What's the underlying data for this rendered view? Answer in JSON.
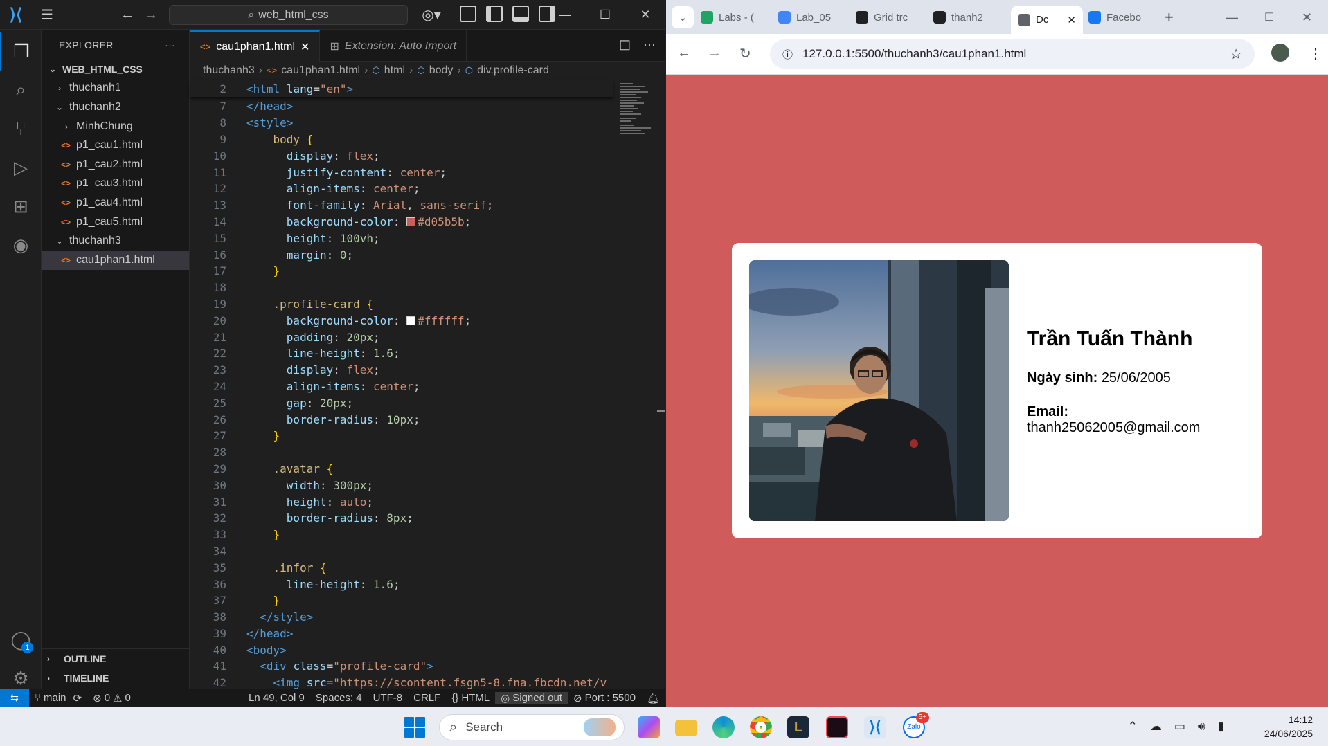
{
  "vscode": {
    "command_center": "web_html_css",
    "explorer_title": "EXPLORER",
    "workspace": "WEB_HTML_CSS",
    "tree": [
      {
        "label": "thuchanh1",
        "type": "folder",
        "open": false,
        "depth": 1
      },
      {
        "label": "thuchanh2",
        "type": "folder",
        "open": true,
        "depth": 1
      },
      {
        "label": "MinhChung",
        "type": "folder",
        "open": false,
        "depth": 2
      },
      {
        "label": "p1_cau1.html",
        "type": "file",
        "depth": 2
      },
      {
        "label": "p1_cau2.html",
        "type": "file",
        "depth": 2
      },
      {
        "label": "p1_cau3.html",
        "type": "file",
        "depth": 2
      },
      {
        "label": "p1_cau4.html",
        "type": "file",
        "depth": 2
      },
      {
        "label": "p1_cau5.html",
        "type": "file",
        "depth": 2
      },
      {
        "label": "thuchanh3",
        "type": "folder",
        "open": true,
        "depth": 1
      },
      {
        "label": "cau1phan1.html",
        "type": "file",
        "depth": 2,
        "selected": true
      }
    ],
    "outline_label": "OUTLINE",
    "timeline_label": "TIMELINE",
    "tabs": [
      {
        "label": "cau1phan1.html",
        "active": true
      },
      {
        "label": "Extension: Auto Import",
        "active": false
      }
    ],
    "breadcrumbs": [
      "thuchanh3",
      "cau1phan1.html",
      "html",
      "body",
      "div.profile-card"
    ],
    "sticky_line": {
      "number": "2",
      "html": "<span class=\"t-tag\">&lt;html</span> <span class=\"t-attr\">lang</span><span class=\"t-pun\">=</span><span class=\"t-str\">\"en\"</span><span class=\"t-tag\">&gt;</span>"
    },
    "code_lines": [
      {
        "n": "7",
        "html": "<span class=\"t-tag\">&lt;/head&gt;</span>"
      },
      {
        "n": "8",
        "html": "<span class=\"t-tag\">&lt;style&gt;</span>"
      },
      {
        "n": "9",
        "html": "    <span class=\"t-sel\">body</span> <span class=\"t-br\">{</span>"
      },
      {
        "n": "10",
        "html": "      <span class=\"t-prop\">display</span><span class=\"t-pun\">: </span><span class=\"t-val\">flex</span><span class=\"t-pun\">;</span>"
      },
      {
        "n": "11",
        "html": "      <span class=\"t-prop\">justify-content</span><span class=\"t-pun\">: </span><span class=\"t-val\">center</span><span class=\"t-pun\">;</span>"
      },
      {
        "n": "12",
        "html": "      <span class=\"t-prop\">align-items</span><span class=\"t-pun\">: </span><span class=\"t-val\">center</span><span class=\"t-pun\">;</span>"
      },
      {
        "n": "13",
        "html": "      <span class=\"t-prop\">font-family</span><span class=\"t-pun\">: </span><span class=\"t-val\">Arial</span><span class=\"t-pun\">, </span><span class=\"t-val\">sans-serif</span><span class=\"t-pun\">;</span>"
      },
      {
        "n": "14",
        "html": "      <span class=\"t-prop\">background-color</span><span class=\"t-pun\">: </span><span class=\"swatch\" style=\"background:#d05b5b\"></span><span class=\"t-val\">#d05b5b</span><span class=\"t-pun\">;</span>"
      },
      {
        "n": "15",
        "html": "      <span class=\"t-prop\">height</span><span class=\"t-pun\">: </span><span class=\"t-num\">100vh</span><span class=\"t-pun\">;</span>"
      },
      {
        "n": "16",
        "html": "      <span class=\"t-prop\">margin</span><span class=\"t-pun\">: </span><span class=\"t-num\">0</span><span class=\"t-pun\">;</span>"
      },
      {
        "n": "17",
        "html": "    <span class=\"t-br\">}</span>"
      },
      {
        "n": "18",
        "html": ""
      },
      {
        "n": "19",
        "html": "    <span class=\"t-sel\">.profile-card</span> <span class=\"t-br\">{</span>"
      },
      {
        "n": "20",
        "html": "      <span class=\"t-prop\">background-color</span><span class=\"t-pun\">: </span><span class=\"swatch\" style=\"background:#ffffff\"></span><span class=\"t-val\">#ffffff</span><span class=\"t-pun\">;</span>"
      },
      {
        "n": "21",
        "html": "      <span class=\"t-prop\">padding</span><span class=\"t-pun\">: </span><span class=\"t-num\">20px</span><span class=\"t-pun\">;</span>"
      },
      {
        "n": "22",
        "html": "      <span class=\"t-prop\">line-height</span><span class=\"t-pun\">: </span><span class=\"t-num\">1.6</span><span class=\"t-pun\">;</span>"
      },
      {
        "n": "23",
        "html": "      <span class=\"t-prop\">display</span><span class=\"t-pun\">: </span><span class=\"t-val\">flex</span><span class=\"t-pun\">;</span>"
      },
      {
        "n": "24",
        "html": "      <span class=\"t-prop\">align-items</span><span class=\"t-pun\">: </span><span class=\"t-val\">center</span><span class=\"t-pun\">;</span>"
      },
      {
        "n": "25",
        "html": "      <span class=\"t-prop\">gap</span><span class=\"t-pun\">: </span><span class=\"t-num\">20px</span><span class=\"t-pun\">;</span>"
      },
      {
        "n": "26",
        "html": "      <span class=\"t-prop\">border-radius</span><span class=\"t-pun\">: </span><span class=\"t-num\">10px</span><span class=\"t-pun\">;</span>"
      },
      {
        "n": "27",
        "html": "    <span class=\"t-br\">}</span>"
      },
      {
        "n": "28",
        "html": ""
      },
      {
        "n": "29",
        "html": "    <span class=\"t-sel\">.avatar</span> <span class=\"t-br\">{</span>"
      },
      {
        "n": "30",
        "html": "      <span class=\"t-prop\">width</span><span class=\"t-pun\">: </span><span class=\"t-num\">300px</span><span class=\"t-pun\">;</span>"
      },
      {
        "n": "31",
        "html": "      <span class=\"t-prop\">height</span><span class=\"t-pun\">: </span><span class=\"t-val\">auto</span><span class=\"t-pun\">;</span>"
      },
      {
        "n": "32",
        "html": "      <span class=\"t-prop\">border-radius</span><span class=\"t-pun\">: </span><span class=\"t-num\">8px</span><span class=\"t-pun\">;</span>"
      },
      {
        "n": "33",
        "html": "    <span class=\"t-br\">}</span>"
      },
      {
        "n": "34",
        "html": ""
      },
      {
        "n": "35",
        "html": "    <span class=\"t-sel\">.infor</span> <span class=\"t-br\">{</span>"
      },
      {
        "n": "36",
        "html": "      <span class=\"t-prop\">line-height</span><span class=\"t-pun\">: </span><span class=\"t-num\">1.6</span><span class=\"t-pun\">;</span>"
      },
      {
        "n": "37",
        "html": "    <span class=\"t-br\">}</span>"
      },
      {
        "n": "38",
        "html": "  <span class=\"t-tag\">&lt;/style&gt;</span>"
      },
      {
        "n": "39",
        "html": "<span class=\"t-tag\">&lt;/head&gt;</span>"
      },
      {
        "n": "40",
        "html": "<span class=\"t-tag\">&lt;body&gt;</span>"
      },
      {
        "n": "41",
        "html": "  <span class=\"t-tag\">&lt;div</span> <span class=\"t-attr\">class</span><span class=\"t-pun\">=</span><span class=\"t-str\">\"profile-card\"</span><span class=\"t-tag\">&gt;</span>"
      },
      {
        "n": "42",
        "html": "    <span class=\"t-tag\">&lt;img</span> <span class=\"t-attr\">src</span><span class=\"t-pun\">=</span><span class=\"t-str\">\"https://scontent.fsgn5-8.fna.fbcdn.net/v</span>"
      }
    ],
    "status": {
      "branch": "main",
      "errors": "0",
      "warnings": "0",
      "position": "Ln 49, Col 9",
      "spaces": "Spaces: 4",
      "encoding": "UTF-8",
      "eol": "CRLF",
      "language": "HTML",
      "account": "Signed out",
      "port": "Port : 5500"
    },
    "accounts_badge": "1"
  },
  "chrome": {
    "tabs": [
      {
        "label": "Labs - (",
        "icon": "google-drive-icon",
        "color": "#1fa463"
      },
      {
        "label": "Lab_05",
        "icon": "google-docs-icon",
        "color": "#4285f4"
      },
      {
        "label": "Grid trc",
        "icon": "openai-icon",
        "color": "#202124"
      },
      {
        "label": "thanh2",
        "icon": "github-icon",
        "color": "#202124"
      },
      {
        "label": "Dc",
        "icon": "globe-icon",
        "color": "#5f6368",
        "active": true
      },
      {
        "label": "Facebo",
        "icon": "facebook-icon",
        "color": "#1877f2"
      }
    ],
    "url": "127.0.0.1:5500/thuchanh3/cau1phan1.html",
    "page_bg": "#d05b5b",
    "profile": {
      "name": "Trần Tuấn Thành",
      "dob_label": "Ngày sinh:",
      "dob": "25/06/2005",
      "email_label": "Email:",
      "email": "thanh25062005@gmail.com"
    }
  },
  "taskbar": {
    "search_placeholder": "Search",
    "time": "14:12",
    "date": "24/06/2025",
    "zalo_badge": "5+"
  }
}
